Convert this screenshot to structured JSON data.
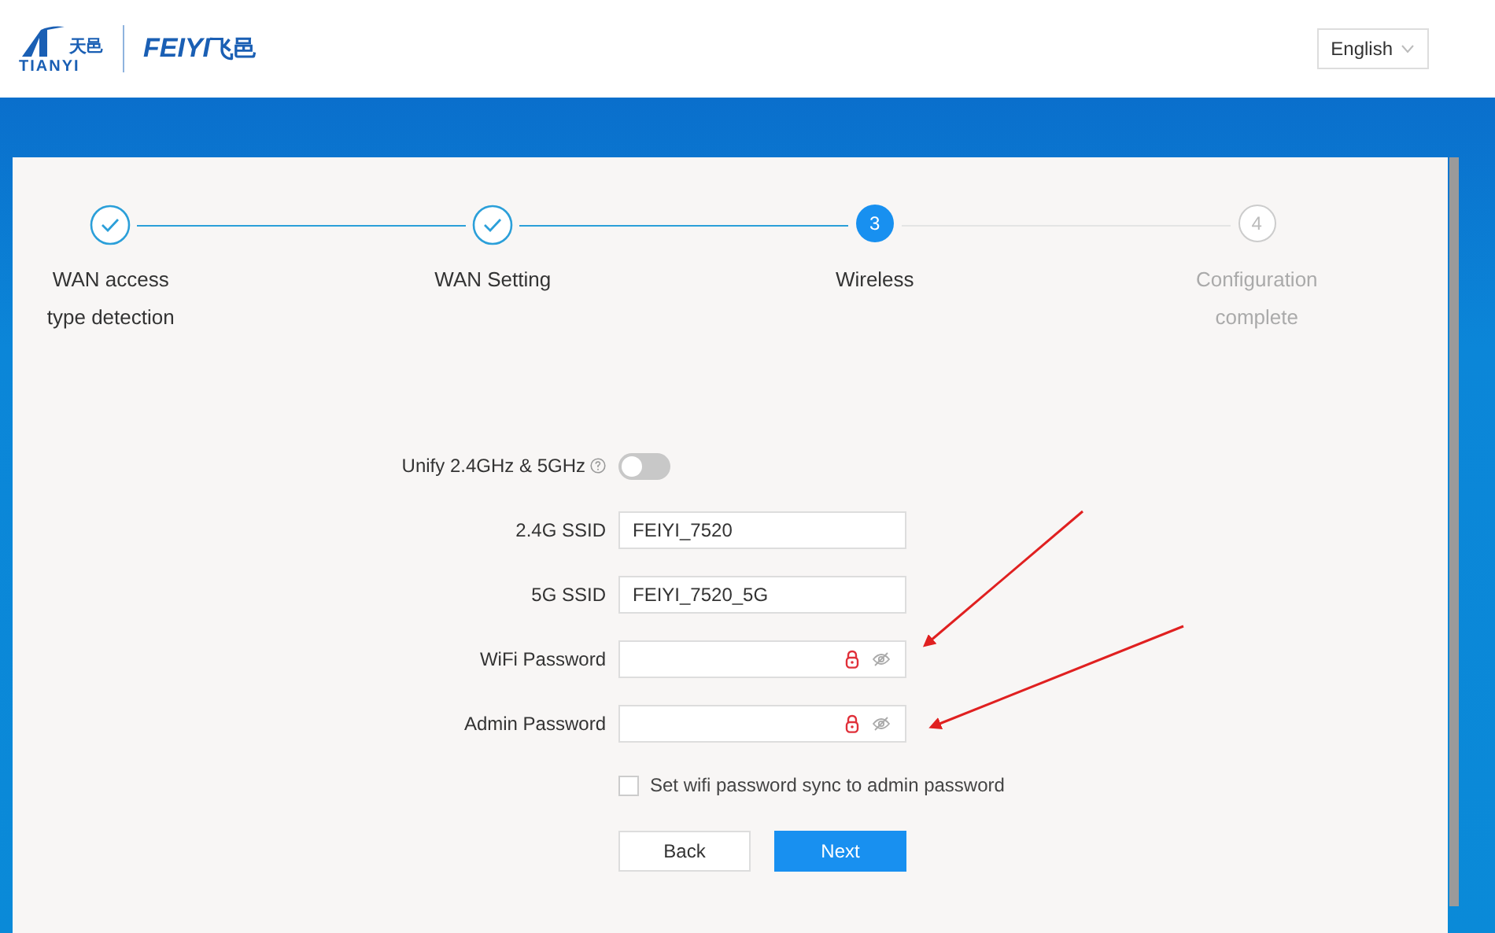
{
  "header": {
    "logo_tianyi": {
      "cn": "天邑",
      "en": "TIANYI"
    },
    "logo_feiyi": {
      "en": "FEIYI",
      "cn": "飞邑"
    },
    "language": "English"
  },
  "steps": [
    {
      "label": "WAN access type detection",
      "completed": true,
      "selected": false
    },
    {
      "label": "WAN Setting",
      "completed": true,
      "selected": false
    },
    {
      "number": "3",
      "label": "Wireless",
      "completed": false,
      "selected": true
    },
    {
      "number": "4",
      "label": "Configuration complete",
      "completed": false,
      "selected": false
    }
  ],
  "form": {
    "unify": {
      "label": "Unify 2.4GHz & 5GHz",
      "on": false
    },
    "fields": [
      {
        "kind": "text",
        "label": "2.4G SSID",
        "value": "FEIYI_7520"
      },
      {
        "kind": "text",
        "label": "5G SSID",
        "value": "FEIYI_7520_5G"
      },
      {
        "kind": "password",
        "label": "WiFi Password"
      },
      {
        "kind": "password",
        "label": "Admin Password"
      }
    ],
    "sync": {
      "label": "Set wifi password sync to admin password",
      "checked": false
    },
    "buttons": [
      {
        "kind": "secondary",
        "label": "Back"
      },
      {
        "kind": "primary",
        "label": "Next"
      }
    ]
  },
  "annotation_arrows": [
    {
      "kind": "arrow"
    },
    {
      "kind": "arrow"
    }
  ]
}
